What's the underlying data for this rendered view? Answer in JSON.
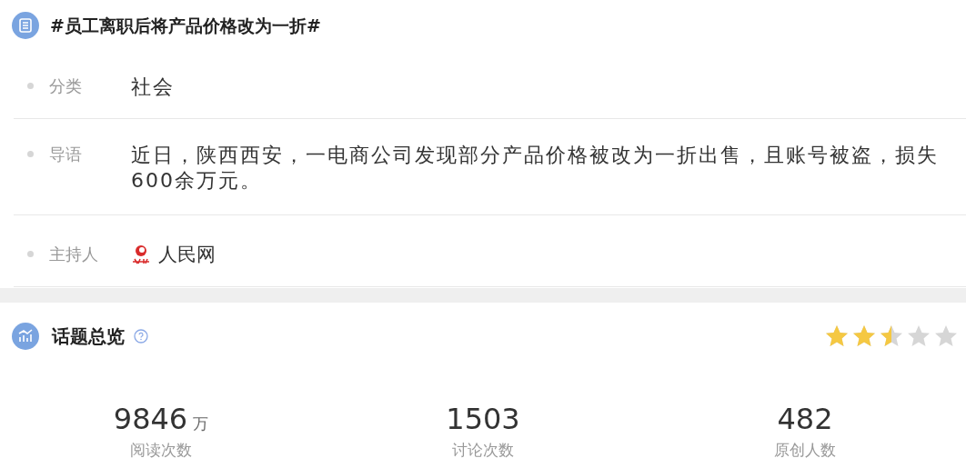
{
  "topic": {
    "title": "#员工离职后将产品价格改为一折#"
  },
  "details": [
    {
      "label": "分类",
      "kind": "text",
      "value": "社会"
    },
    {
      "label": "导语",
      "kind": "text",
      "value": "近日，陕西西安，一电商公司发现部分产品价格被改为一折出售，且账号被盗，损失600余万元。"
    },
    {
      "label": "主持人",
      "kind": "host",
      "value": "人民网"
    }
  ],
  "overview": {
    "title": "话题总览",
    "stars": 2.5,
    "stats": [
      {
        "value": "9846",
        "unit": "万",
        "label": "阅读次数"
      },
      {
        "value": "1503",
        "label": "讨论次数"
      },
      {
        "value": "482",
        "label": "原创人数"
      }
    ]
  }
}
